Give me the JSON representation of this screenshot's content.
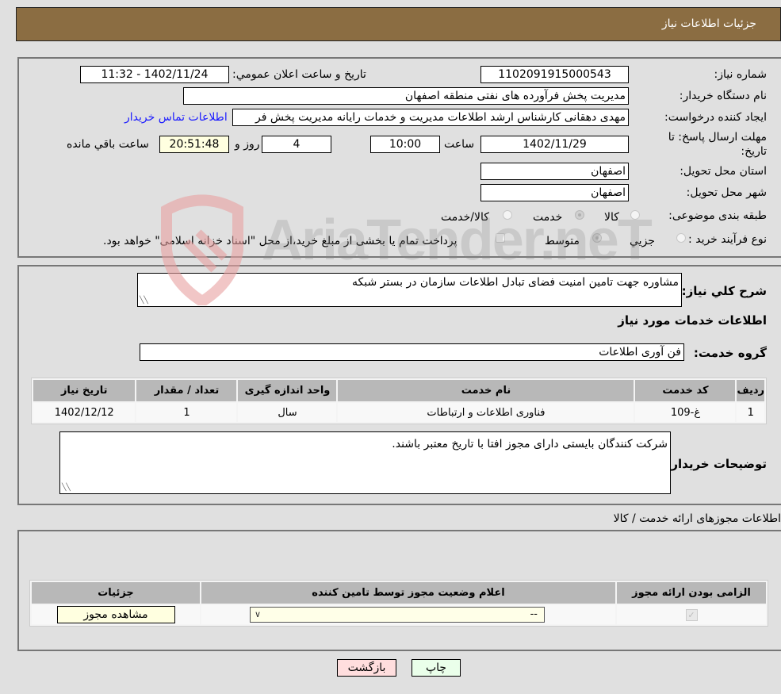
{
  "header": {
    "title": "جزئیات اطلاعات نیاز"
  },
  "form": {
    "need_number_label": "شماره نیاز:",
    "need_number": "1102091915000543",
    "announce_label": "تاریخ و ساعت اعلان عمومي:",
    "announce_value": "1402/11/24 - 11:32",
    "buyer_org_label": "نام دستگاه خریدار:",
    "buyer_org": "مدیریت پخش فرآورده های نفتی منطقه اصفهان",
    "creator_label": "ایجاد کننده درخواست:",
    "creator": "مهدی دهقانی کارشناس ارشد اطلاعات مدیریت و خدمات رایانه مدیریت پخش فر",
    "contact_link": "اطلاعات تماس خریدار",
    "deadline_label_1": "مهلت ارسال پاسخ: تا",
    "deadline_label_2": "تاریخ:",
    "deadline_date": "1402/11/29",
    "time_label": "ساعت",
    "deadline_time": "10:00",
    "days_value": "4",
    "days_label": "روز و",
    "remaining_time": "20:51:48",
    "remaining_label": "ساعت باقي مانده",
    "province_label": "استان محل تحویل:",
    "province": "اصفهان",
    "city_label": "شهر محل تحویل:",
    "city": "اصفهان",
    "category_label": "طبقه بندی موضوعی:",
    "category_options": [
      {
        "label": "کالا",
        "selected": false
      },
      {
        "label": "خدمت",
        "selected": true
      },
      {
        "label": "کالا/خدمت",
        "selected": false
      }
    ],
    "process_label": "نوع فرآیند خرید :",
    "process_options": [
      {
        "label": "جزيي",
        "selected": false
      },
      {
        "label": "متوسط",
        "selected": true
      }
    ],
    "treasury_note": "پرداخت تمام یا بخشی از مبلغ خرید،از محل \"اسناد خزانه اسلامی\" خواهد بود."
  },
  "description": {
    "label": "شرح كلي نياز:",
    "value": "مشاوره جهت تامین امنیت فضای تبادل اطلاعات سازمان در بستر شبکه",
    "services_heading": "اطلاعات خدمات مورد نیاز",
    "group_label": "گروه خدمت:",
    "group_value": "فن آوری اطلاعات"
  },
  "services_table": {
    "headers": [
      "ردیف",
      "کد خدمت",
      "نام خدمت",
      "واحد اندازه گیری",
      "تعداد / مقدار",
      "تاریخ نیاز"
    ],
    "rows": [
      [
        "1",
        "غ-109",
        "فناوری اطلاعات و ارتباطات",
        "سال",
        "1",
        "1402/12/12"
      ]
    ]
  },
  "buyer_notes": {
    "label": "توضیحات خریدار:",
    "value": "شرکت کنندگان بایستی دارای مجوز افتا با تاریخ معتبر باشند."
  },
  "permits": {
    "heading": "اطلاعات مجوزهای ارائه خدمت / کالا",
    "headers": [
      "الزامی بودن ارائه مجوز",
      "اعلام وضعیت مجوز توسط تامین کننده",
      "جزئیات"
    ],
    "row": {
      "required_checked": true,
      "status_select": "--",
      "details_button": "مشاهده مجوز"
    }
  },
  "footer": {
    "print_button": "چاپ",
    "back_button": "بازگشت"
  },
  "watermark": {
    "text": "AriaTender.neT"
  },
  "colors": {
    "header_bg": "#8b6d42",
    "print_bg": "#eaffea",
    "back_bg": "#ffdede",
    "highlight_bg": "#ffffe0"
  }
}
